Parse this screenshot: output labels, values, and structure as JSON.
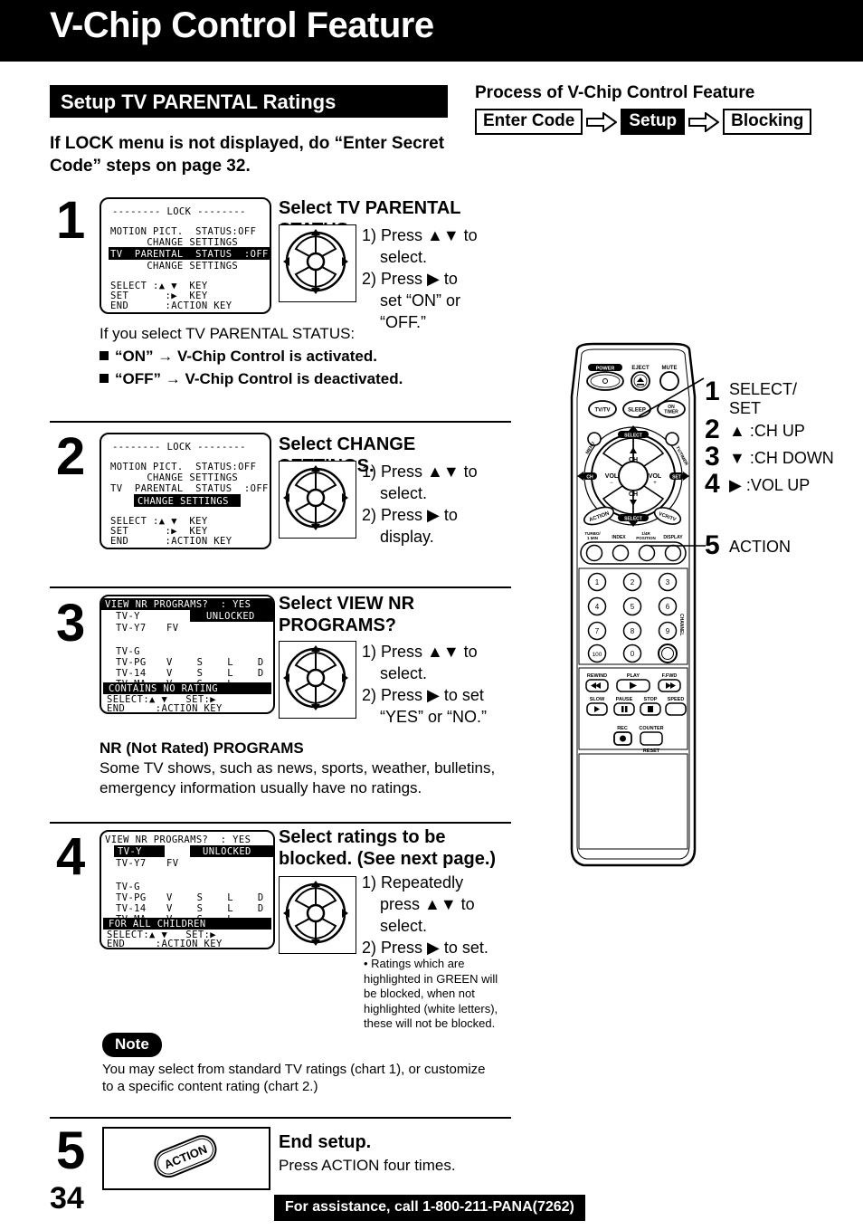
{
  "header": {
    "title": "V-Chip Control Feature",
    "section_title": "Setup TV PARENTAL Ratings",
    "lead_text": "If LOCK menu is not displayed, do “Enter Secret Code” steps on page 32.",
    "process_title": "Process of V-Chip Control Feature",
    "flow": [
      {
        "label": "Enter Code",
        "active": false
      },
      {
        "label": "Setup",
        "active": true
      },
      {
        "label": "Blocking",
        "active": false
      }
    ],
    "arrow_icon": "right-arrow-outline-icon"
  },
  "steps": [
    {
      "number": "1",
      "osd": {
        "title": "-------- LOCK --------",
        "rows": [
          "MOTION PICT.  STATUS:OFF",
          "      CHANGE SETTINGS",
          "TV  PARENTAL  STATUS  :OFF",
          "      CHANGE SETTINGS"
        ],
        "highlight_row": 2,
        "footer": [
          "SELECT :▲ ▼  KEY",
          "SET      :▶  KEY",
          "END      :ACTION KEY"
        ]
      },
      "heading": "Select TV PARENTAL STATUS.",
      "instructions": [
        "1) Press ▲▼ to\n    select.",
        "2) Press ▶ to\n    set “ON” or\n    “OFF.”"
      ]
    },
    {
      "number": "2",
      "osd": {
        "title": "-------- LOCK --------",
        "rows": [
          "MOTION PICT.  STATUS:OFF",
          "      CHANGE SETTINGS",
          "TV  PARENTAL  STATUS  :OFF",
          "CHANGE SETTINGS"
        ],
        "highlight_row": 3,
        "footer": [
          "SELECT :▲ ▼  KEY",
          "SET      :▶  KEY",
          "END      :ACTION KEY"
        ]
      },
      "heading": "Select CHANGE SETTINGS.",
      "instructions": [
        "1) Press ▲▼ to\n    select.",
        "2) Press ▶ to\n    display."
      ]
    },
    {
      "number": "3",
      "osd": {
        "title_row": "VIEW NR PROGRAMS?  : YES",
        "unlocked": "UNLOCKED",
        "ratings": [
          {
            "name": "TV-Y",
            "flags": ""
          },
          {
            "name": "TV-Y7",
            "flags": "FV"
          },
          {
            "name": "",
            "flags": ""
          },
          {
            "name": "TV-G",
            "flags": ""
          },
          {
            "name": "TV-PG",
            "flags": "V    S    L    D"
          },
          {
            "name": "TV-14",
            "flags": "V    S    L    D"
          },
          {
            "name": "TV-MA",
            "flags": "V    S    L"
          }
        ],
        "banner": "CONTAINS NO RATING",
        "footer": [
          "SELECT:▲ ▼   SET:▶",
          "END     :ACTION KEY"
        ],
        "selected_rating": null
      },
      "heading": "Select VIEW NR PROGRAMS?",
      "instructions": [
        "1) Press ▲▼ to\n    select.",
        "2) Press ▶ to set\n    “YES” or “NO.”"
      ],
      "after": {
        "subtitle": "NR (Not Rated) PROGRAMS",
        "text": "Some TV shows, such as news, sports, weather, bulletins, emergency information usually have no ratings."
      }
    },
    {
      "number": "4",
      "osd": {
        "title_row": "VIEW NR PROGRAMS?  : YES",
        "unlocked": "UNLOCKED",
        "ratings": [
          {
            "name": "TV-Y",
            "flags": ""
          },
          {
            "name": "TV-Y7",
            "flags": "FV"
          },
          {
            "name": "",
            "flags": ""
          },
          {
            "name": "TV-G",
            "flags": ""
          },
          {
            "name": "TV-PG",
            "flags": "V    S    L    D"
          },
          {
            "name": "TV-14",
            "flags": "V    S    L    D"
          },
          {
            "name": "TV-MA",
            "flags": "V    S    L"
          }
        ],
        "banner": "FOR ALL CHILDREN",
        "footer": [
          "SELECT:▲ ▼   SET:▶",
          "END     :ACTION KEY"
        ],
        "selected_rating": "TV-Y"
      },
      "heading": "Select ratings to be blocked. (See next page.)",
      "instructions": [
        "1) Repeatedly\n    press ▲▼ to\n    select.",
        "2) Press ▶ to set."
      ],
      "bullet": "• Ratings which are highlighted in GREEN will be blocked, when not highlighted (white letters), these will not be blocked."
    },
    {
      "number": "5",
      "heading": "End setup.",
      "text": "Press ACTION four times.",
      "button_label": "ACTION"
    }
  ],
  "note": {
    "label": "Note",
    "text": "You may select from standard TV ratings (chart 1), or customize to a specific content rating (chart 2.)"
  },
  "remote": {
    "top_buttons": [
      "POWER",
      "EJECT",
      "MUTE"
    ],
    "second_row": [
      "TV/TV",
      "SLEEP",
      "ON TIMER"
    ],
    "dpad": {
      "up": "CH",
      "down": "CH",
      "left": "VOL",
      "right": "VOL",
      "center": "SELECT",
      "left_side": "MENU",
      "right_side": "TV/TIMER",
      "left_corner": "CH",
      "right_corner": "SET"
    },
    "bottom_row": [
      "ACTION",
      "SELECT",
      "VCR/TV"
    ],
    "function_labels": [
      "TURBO/1 MIN",
      "INDEX",
      "1/4R POSITION",
      "DISPLAY"
    ],
    "keypad": [
      "1",
      "2",
      "3",
      "4",
      "5",
      "6",
      "7",
      "8",
      "9",
      "100",
      "0"
    ],
    "keypad_side_label": "CHANNEL",
    "transport_top": [
      "REWIND",
      "PLAY",
      "F.FWD"
    ],
    "transport_bottom": [
      "SLOW",
      "PAUSE",
      "STOP",
      "SPEED"
    ],
    "rec_label": "REC",
    "counter_label": "COUNTER",
    "reset_label": "RESET"
  },
  "callouts": [
    {
      "num": "1",
      "lines": "SELECT/\nSET"
    },
    {
      "num": "2",
      "lines": "▲ :CH UP"
    },
    {
      "num": "3",
      "lines": "▼ :CH DOWN"
    },
    {
      "num": "4",
      "lines": "▶ :VOL UP"
    },
    {
      "num": "5",
      "lines": "ACTION"
    }
  ],
  "footer": {
    "page_number": "34",
    "assistance": "For assistance, call 1-800-211-PANA(7262)"
  }
}
